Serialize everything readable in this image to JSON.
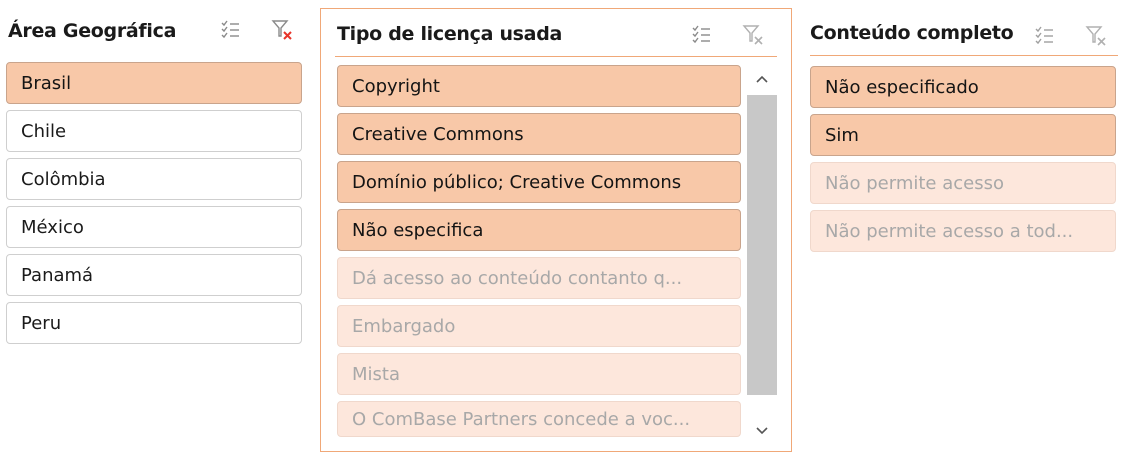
{
  "slicers": [
    {
      "title": "Área Geográfica",
      "items": [
        {
          "label": "Brasil",
          "state": "selected"
        },
        {
          "label": "Chile",
          "state": "unselected"
        },
        {
          "label": "Colômbia",
          "state": "unselected"
        },
        {
          "label": "México",
          "state": "unselected"
        },
        {
          "label": "Panamá",
          "state": "unselected"
        },
        {
          "label": "Peru",
          "state": "unselected"
        }
      ]
    },
    {
      "title": "Tipo de licença usada",
      "items": [
        {
          "label": "Copyright",
          "state": "selected"
        },
        {
          "label": "Creative Commons",
          "state": "selected"
        },
        {
          "label": "Domínio público; Creative Commons",
          "state": "selected"
        },
        {
          "label": "Não especifica",
          "state": "selected"
        },
        {
          "label": "Dá acesso ao conteúdo contanto q...",
          "state": "nodata"
        },
        {
          "label": "Embargado",
          "state": "nodata"
        },
        {
          "label": "Mista",
          "state": "nodata"
        },
        {
          "label": "O ComBase Partners concede a voc...",
          "state": "nodata"
        }
      ]
    },
    {
      "title": "Conteúdo completo",
      "items": [
        {
          "label": "Não especificado",
          "state": "selected"
        },
        {
          "label": "Sim",
          "state": "selected"
        },
        {
          "label": "Não permite acesso",
          "state": "nodata"
        },
        {
          "label": "Não permite acesso a tod...",
          "state": "nodata"
        }
      ]
    }
  ],
  "icons": {
    "multiselect": "multi-select-icon",
    "clear_filter": "clear-filter-icon",
    "scroll_up": "scroll-up-icon",
    "scroll_down": "scroll-down-icon"
  },
  "colors": {
    "selected_fill": "#f8c8a8",
    "nodata_fill": "#fde7dc",
    "slicer_border": "#f0a878",
    "clear_filter_x": "#e8342a"
  }
}
